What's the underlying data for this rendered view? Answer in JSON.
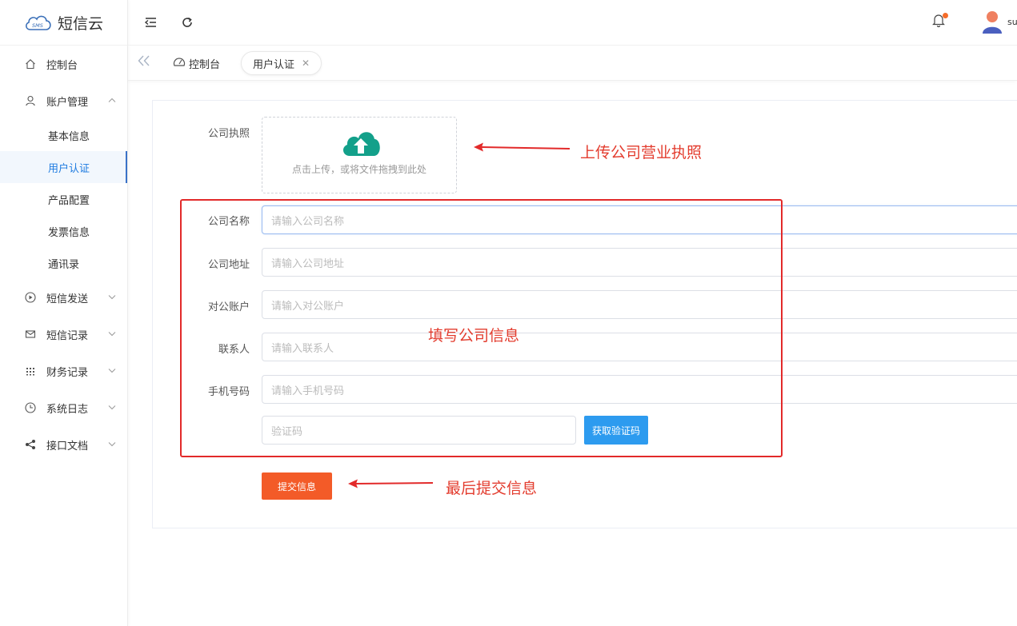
{
  "app": {
    "logo_badge": "SMS",
    "logo_text": "短信云"
  },
  "sidebar": {
    "items": [
      {
        "label": "控制台",
        "icon": "home-icon"
      },
      {
        "label": "账户管理",
        "icon": "user-icon",
        "expanded": true
      },
      {
        "label": "短信发送",
        "icon": "play-circle-icon"
      },
      {
        "label": "短信记录",
        "icon": "mail-icon"
      },
      {
        "label": "财务记录",
        "icon": "grid-icon"
      },
      {
        "label": "系统日志",
        "icon": "clock-icon"
      },
      {
        "label": "接口文档",
        "icon": "share-icon"
      }
    ],
    "sub_items": [
      "基本信息",
      "用户认证",
      "产品配置",
      "发票信息",
      "通讯录"
    ],
    "active_sub": "用户认证"
  },
  "header": {
    "user_name": "su"
  },
  "tabs": {
    "home": "控制台",
    "current": "用户认证"
  },
  "form": {
    "license_label": "公司执照",
    "upload_text": "点击上传，或将文件拖拽到此处",
    "fields": [
      {
        "label": "公司名称",
        "placeholder": "请输入公司名称"
      },
      {
        "label": "公司地址",
        "placeholder": "请输入公司地址"
      },
      {
        "label": "对公账户",
        "placeholder": "请输入对公账户"
      },
      {
        "label": "联系人",
        "placeholder": "请输入联系人"
      },
      {
        "label": "手机号码",
        "placeholder": "请输入手机号码"
      }
    ],
    "code_placeholder": "验证码",
    "get_code_button": "获取验证码",
    "submit_button": "提交信息"
  },
  "annotations": {
    "upload_note": "上传公司营业执照",
    "fill_note": "填写公司信息",
    "submit_note": "最后提交信息"
  },
  "colors": {
    "accent": "#1e7be0",
    "upload_icon": "#13a08a",
    "code_button": "#2d9bef",
    "submit_button": "#f35b28",
    "annotation": "#e22a2a"
  }
}
